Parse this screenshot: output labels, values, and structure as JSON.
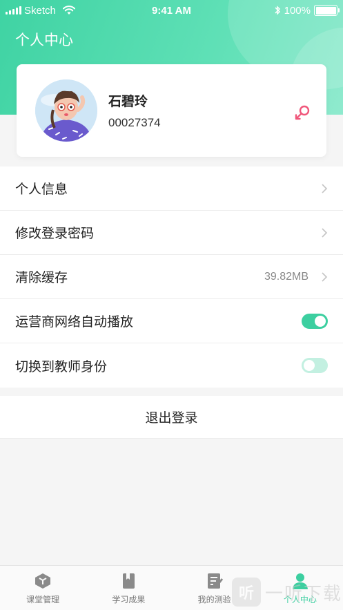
{
  "status_bar": {
    "carrier": "Sketch",
    "time": "9:41 AM",
    "battery": "100%"
  },
  "page": {
    "title": "个人中心"
  },
  "profile": {
    "name": "石碧玲",
    "id": "00027374",
    "gender_icon": "female-icon",
    "gender_color": "#f0567a"
  },
  "menu": {
    "items": [
      {
        "label": "个人信息",
        "type": "link"
      },
      {
        "label": "修改登录密码",
        "type": "link"
      },
      {
        "label": "清除缓存",
        "value": "39.82MB",
        "type": "link"
      },
      {
        "label": "运营商网络自动播放",
        "type": "toggle",
        "on": true
      },
      {
        "label": "切换到教师身份",
        "type": "toggle",
        "on": false
      }
    ]
  },
  "logout": {
    "label": "退出登录"
  },
  "tabbar": {
    "tabs": [
      {
        "label": "课堂管理",
        "icon": "classroom-icon",
        "active": false
      },
      {
        "label": "学习成果",
        "icon": "book-icon",
        "active": false
      },
      {
        "label": "我的测验",
        "icon": "quiz-icon",
        "active": false
      },
      {
        "label": "个人中心",
        "icon": "user-icon",
        "active": true
      }
    ]
  },
  "watermark": {
    "badge": "听",
    "text": "一听下载"
  },
  "colors": {
    "accent": "#3ccfa0",
    "header_gradient_start": "#3fd3a3",
    "header_gradient_end": "#7de7c6",
    "tab_inactive": "#8a8a8a"
  }
}
